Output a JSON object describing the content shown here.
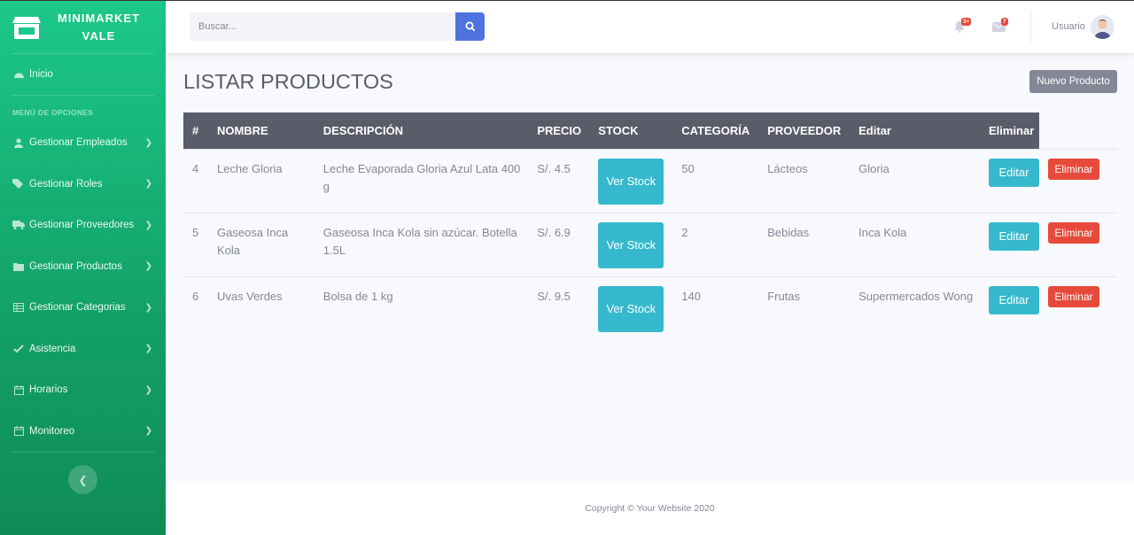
{
  "brand": {
    "line1": "MINIMARKET",
    "line2": "VALE"
  },
  "sidebar": {
    "home_label": "Inicio",
    "heading": "MENÚ DE OPCIONES",
    "items": [
      {
        "label": "Gestionar Empleados",
        "icon": "user-icon"
      },
      {
        "label": "Gestionar Roles",
        "icon": "tags-icon"
      },
      {
        "label": "Gestionar Proveedores",
        "icon": "truck-icon"
      },
      {
        "label": "Gestionar Productos",
        "icon": "folder-icon"
      },
      {
        "label": "Gestionar Categorias",
        "icon": "table-icon"
      },
      {
        "label": "Asistencia",
        "icon": "check-icon"
      },
      {
        "label": "Horarios",
        "icon": "calendar-icon"
      },
      {
        "label": "Monitoreo",
        "icon": "calendar-icon"
      }
    ]
  },
  "topbar": {
    "search_placeholder": "Buscar...",
    "alerts_badge": "3+",
    "messages_badge": "7",
    "user_name": "Usuario"
  },
  "page": {
    "title": "LISTAR PRODUCTOS",
    "new_button": "Nuevo Producto"
  },
  "table": {
    "headers": [
      "#",
      "NOMBRE",
      "DESCRIPCIÓN",
      "PRECIO",
      "STOCK",
      "CATEGORÍA",
      "PROVEEDOR",
      "Editar",
      "Eliminar"
    ],
    "stock_button": "Ver Stock",
    "edit_button": "Editar",
    "delete_button": "Eliminar",
    "rows": [
      {
        "id": "4",
        "nombre": "Leche Gloria",
        "descripcion": "Leche Evaporada Gloria Azul Lata 400 g",
        "precio": "S/. 4.5",
        "categoria": "50",
        "proveedor": "Lácteos",
        "extra": "Gloria"
      },
      {
        "id": "5",
        "nombre": "Gaseosa Inca Kola",
        "descripcion": "Gaseosa Inca Kola sin azúcar. Botella 1.5L",
        "precio": "S/. 6.9",
        "categoria": "2",
        "proveedor": "Bebidas",
        "extra": "Inca Kola"
      },
      {
        "id": "6",
        "nombre": "Uvas Verdes",
        "descripcion": "Bolsa de 1 kg",
        "precio": "S/. 9.5",
        "categoria": "140",
        "proveedor": "Frutas",
        "extra": "Supermercados Wong"
      }
    ]
  },
  "footer": {
    "text": "Copyright © Your Website 2020"
  },
  "colors": {
    "sidebar_top": "#1cc88a",
    "sidebar_bottom": "#0f8c56",
    "primary": "#4e73df",
    "info": "#36b9cc",
    "danger": "#e74a3b",
    "secondary": "#858796",
    "header": "#5a5c69"
  }
}
